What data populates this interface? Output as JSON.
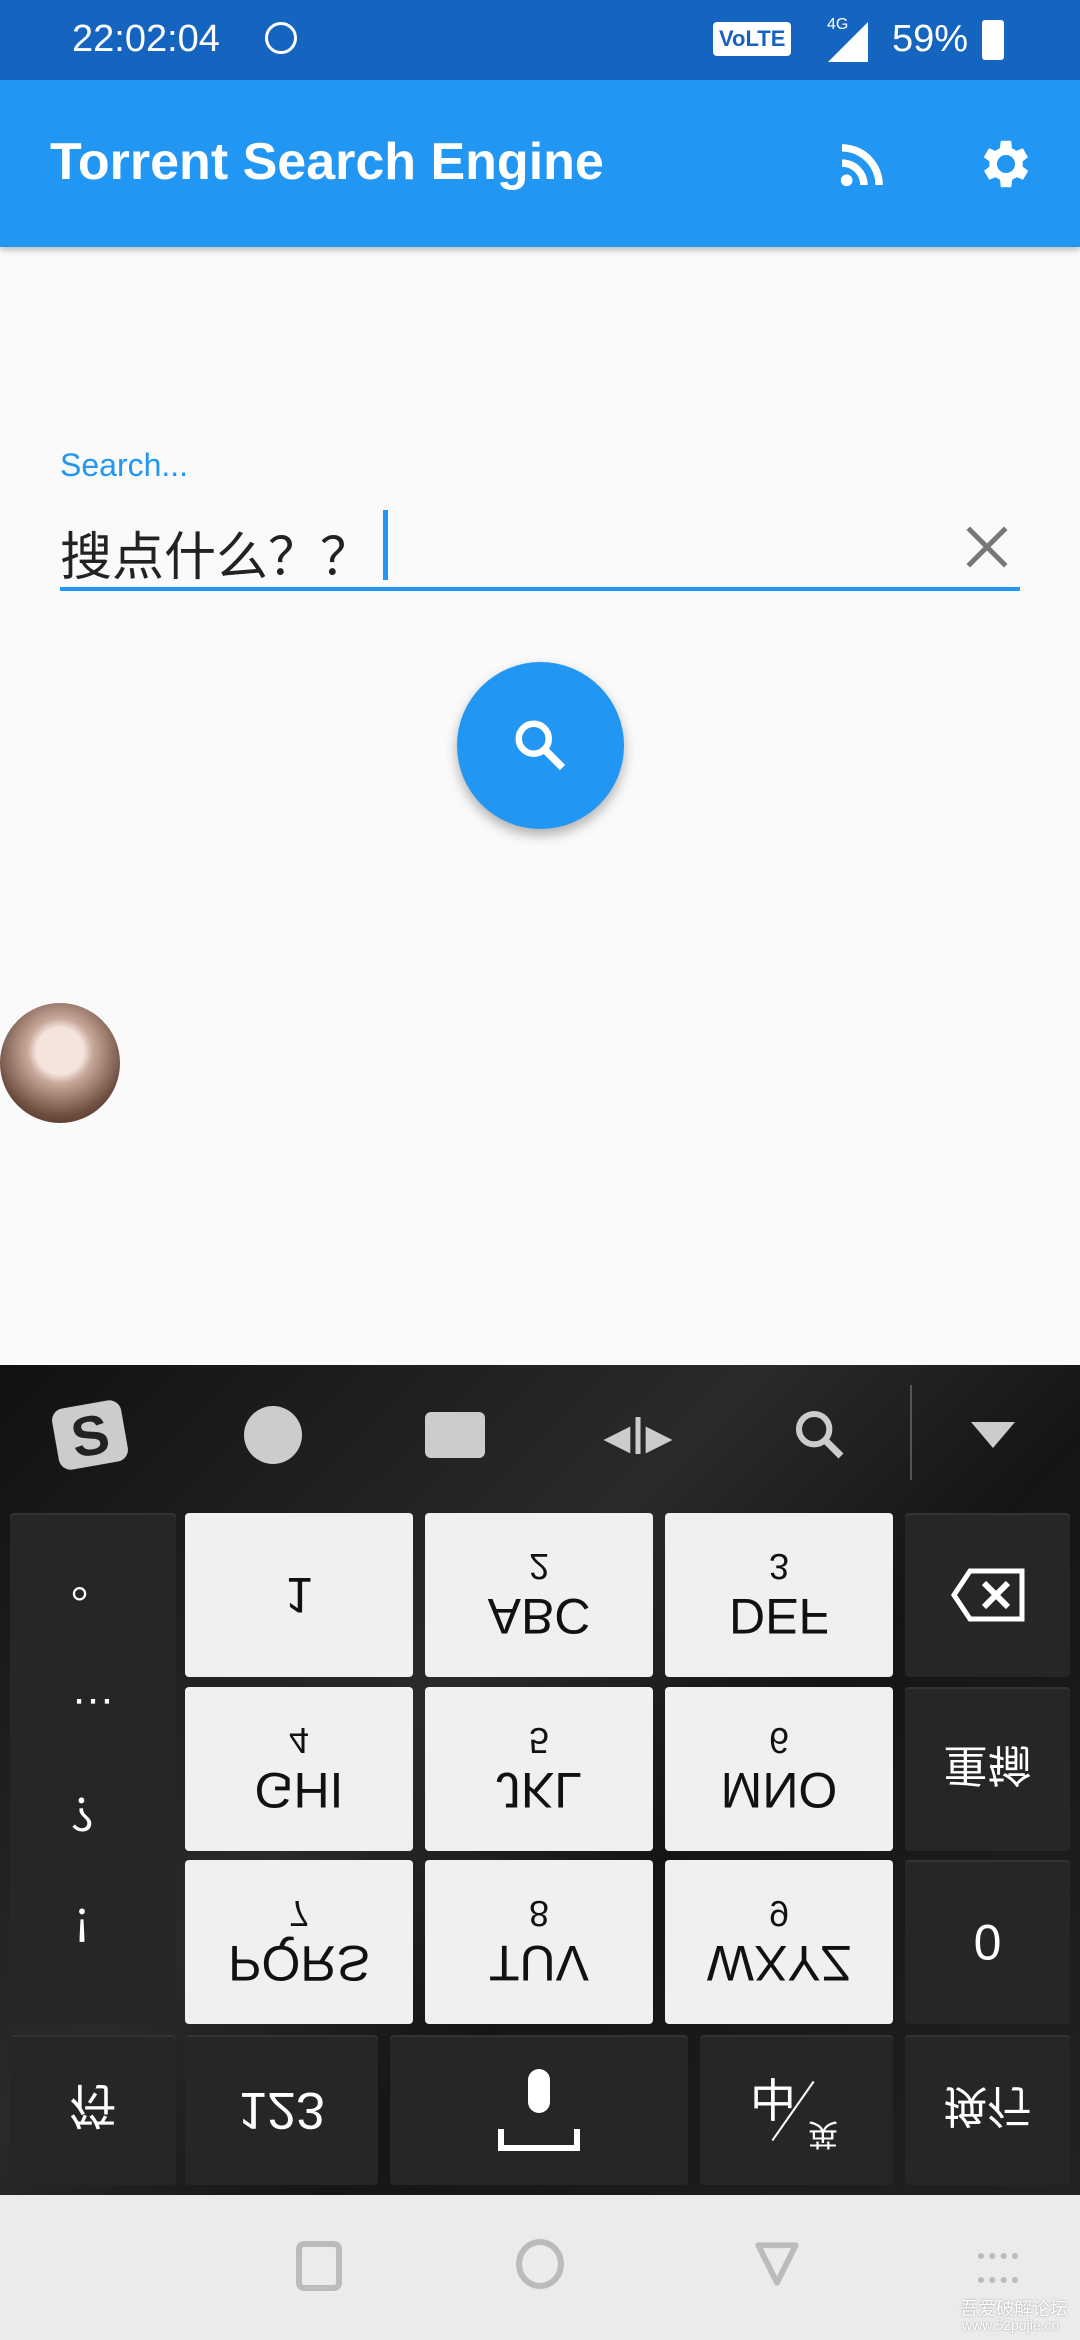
{
  "status": {
    "time": "22:02:04",
    "volte": "VoLTE",
    "network": "4G",
    "battery": "59%"
  },
  "appbar": {
    "title": "Torrent Search Engine",
    "icons": [
      "rss-icon",
      "gear-icon"
    ]
  },
  "search": {
    "label": "Search...",
    "value": "搜点什么？？",
    "clear_icon": "close-icon",
    "button_icon": "search-icon"
  },
  "accent": "#2196F3",
  "keyboard": {
    "toolbar": [
      "sogou-logo-icon",
      "emoji-icon",
      "keyboard-icon",
      "cursor-move-icon",
      "search-icon",
      "collapse-icon"
    ],
    "punct": [
      "。",
      "…",
      "？",
      "！"
    ],
    "keys": [
      {
        "num": "",
        "letters": "1"
      },
      {
        "num": "2",
        "letters": "ABC"
      },
      {
        "num": "3",
        "letters": "DEF"
      },
      {
        "num": "4",
        "letters": "GHI"
      },
      {
        "num": "5",
        "letters": "JKL"
      },
      {
        "num": "6",
        "letters": "MNO"
      },
      {
        "num": "7",
        "letters": "PQRS"
      },
      {
        "num": "8",
        "letters": "TUV"
      },
      {
        "num": "9",
        "letters": "WXYZ"
      }
    ],
    "reinput": "重输",
    "zero": "0",
    "symbols": "符",
    "numbers": "123",
    "lang_zh": "中",
    "lang_en": "英",
    "enter": "换行"
  },
  "watermark": {
    "line1": "吾爱破解论坛",
    "line2": "www.52pojie.cn"
  }
}
